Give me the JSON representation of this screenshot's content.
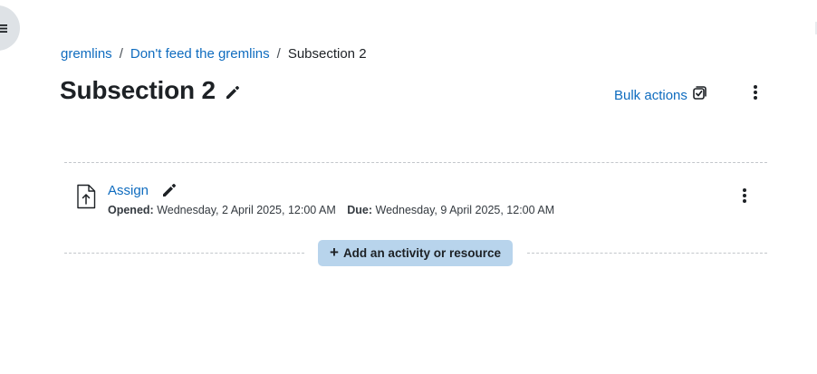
{
  "breadcrumb": {
    "items": [
      "gremlins",
      "Don't feed the gremlins"
    ],
    "separator": "/",
    "current": "Subsection 2"
  },
  "page": {
    "title": "Subsection 2",
    "bulk_actions_label": "Bulk actions"
  },
  "activity": {
    "name": "Assign",
    "opened_label": "Opened:",
    "opened_value": "Wednesday, 2 April 2025, 12:00 AM",
    "due_label": "Due:",
    "due_value": "Wednesday, 9 April 2025, 12:00 AM",
    "icon": "assignment-upload-icon"
  },
  "add_activity": {
    "plus": "+",
    "label": "Add an activity or resource"
  },
  "colors": {
    "link": "#0f6cbf",
    "text": "#1d2125",
    "add_button_bg": "#b8d4ec",
    "drawer_toggle_bg": "#dee2e6"
  }
}
